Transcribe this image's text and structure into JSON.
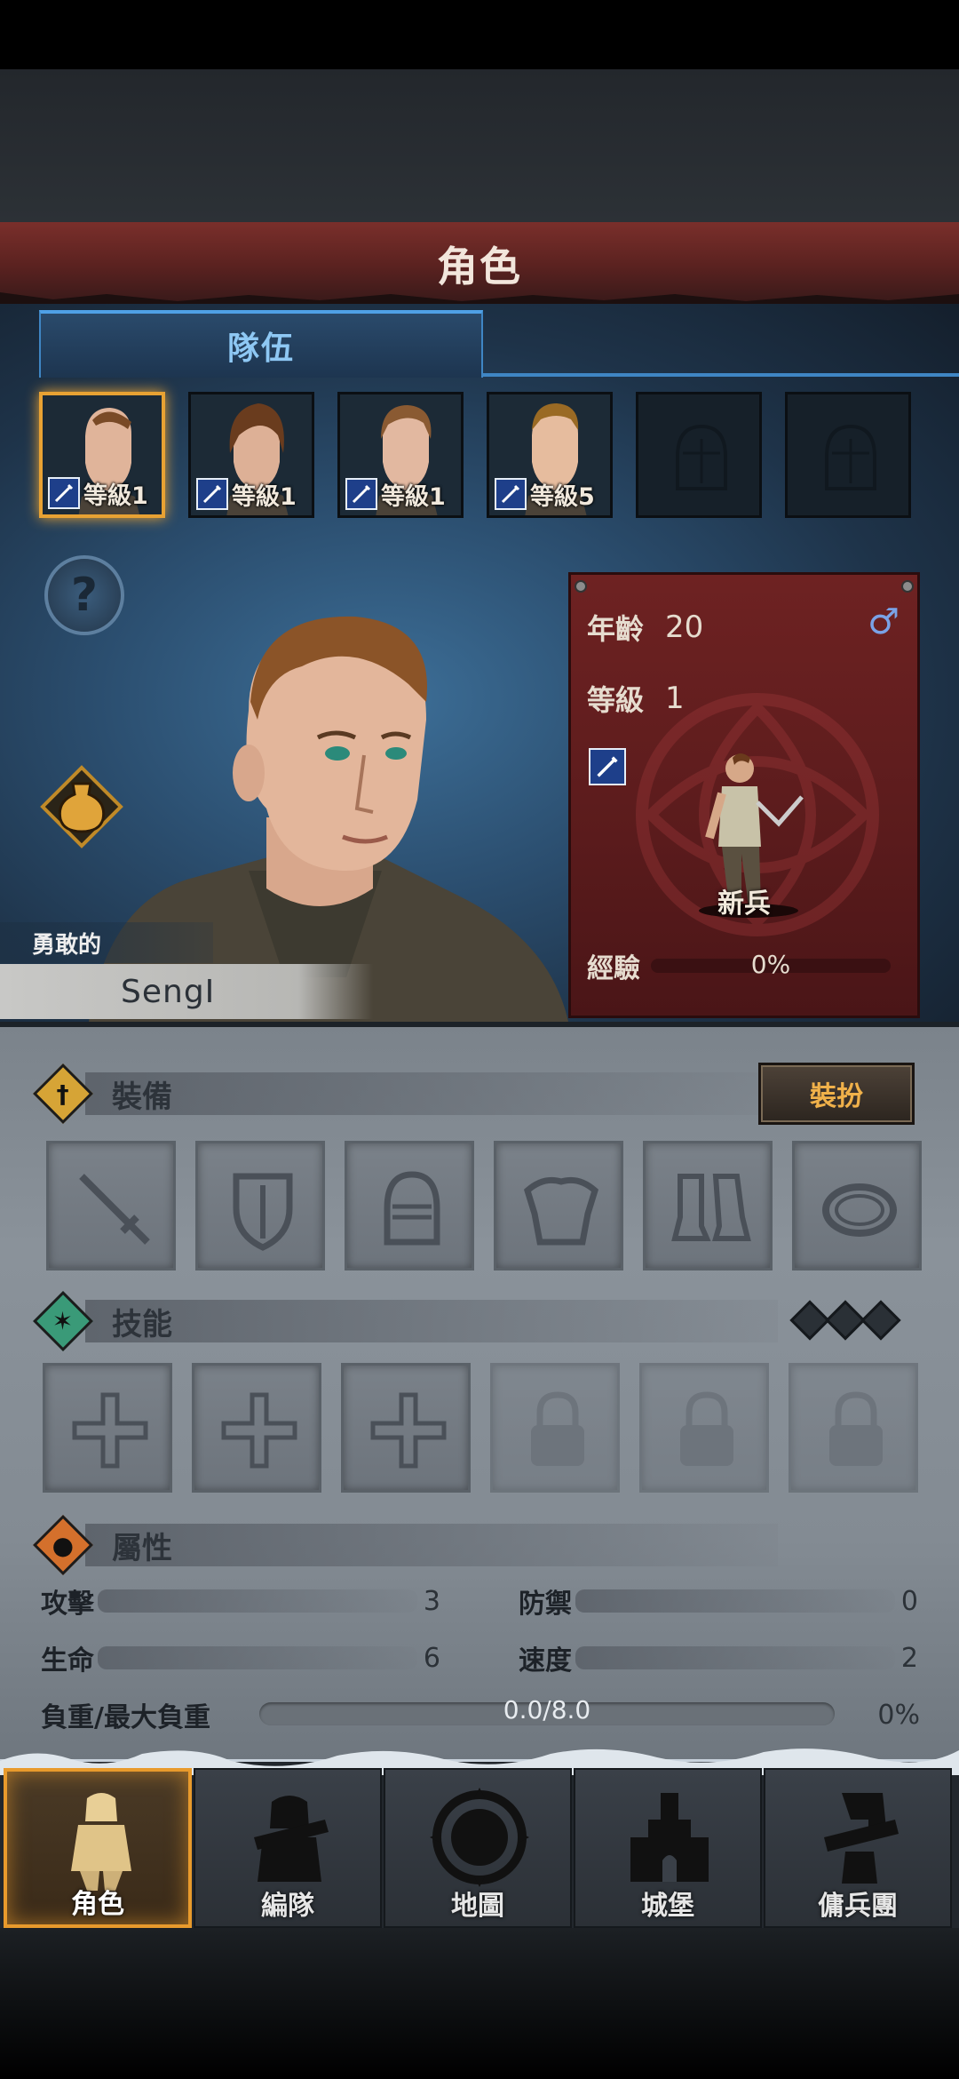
{
  "header": {
    "title": "角色"
  },
  "tabs": [
    {
      "label": "隊伍",
      "active": true
    }
  ],
  "team": [
    {
      "level_label": "等級1",
      "active": true
    },
    {
      "level_label": "等級1",
      "active": false
    },
    {
      "level_label": "等級1",
      "active": false
    },
    {
      "level_label": "等級5",
      "active": false
    },
    {
      "empty": true
    },
    {
      "empty": true
    }
  ],
  "character": {
    "trait": "勇敢的",
    "name": "SengI",
    "age_label": "年齡",
    "age": "20",
    "level_label": "等級",
    "level": "1",
    "gender_icon": "male-icon",
    "class_name": "新兵",
    "exp_label": "經驗",
    "exp_percent": "0%"
  },
  "equipment": {
    "title": "裝備",
    "dress_button": "裝扮",
    "slots": [
      "sword-icon",
      "shield-icon",
      "helmet-icon",
      "armor-icon",
      "boots-icon",
      "ring-icon"
    ]
  },
  "skills": {
    "title": "技能",
    "slots": [
      "cross-icon",
      "cross-icon",
      "cross-icon",
      "lock-icon",
      "lock-icon",
      "lock-icon"
    ]
  },
  "attributes": {
    "title": "屬性",
    "attack_label": "攻擊",
    "attack": "3",
    "defense_label": "防禦",
    "defense": "0",
    "hp_label": "生命",
    "hp": "6",
    "speed_label": "速度",
    "speed": "2",
    "load_label": "負重/最大負重",
    "load": "0.0/8.0",
    "load_percent": "0%"
  },
  "nav": [
    {
      "label": "角色",
      "active": true,
      "icon": "knight-icon"
    },
    {
      "label": "編隊",
      "active": false,
      "icon": "squad-icon"
    },
    {
      "label": "地圖",
      "active": false,
      "icon": "compass-map-icon"
    },
    {
      "label": "城堡",
      "active": false,
      "icon": "castle-icon"
    },
    {
      "label": "傭兵團",
      "active": false,
      "icon": "mercenary-icon"
    }
  ],
  "colors": {
    "accent": "#e89a2c",
    "tab_blue": "#4fa0e6",
    "banner_red": "#6e2222"
  }
}
